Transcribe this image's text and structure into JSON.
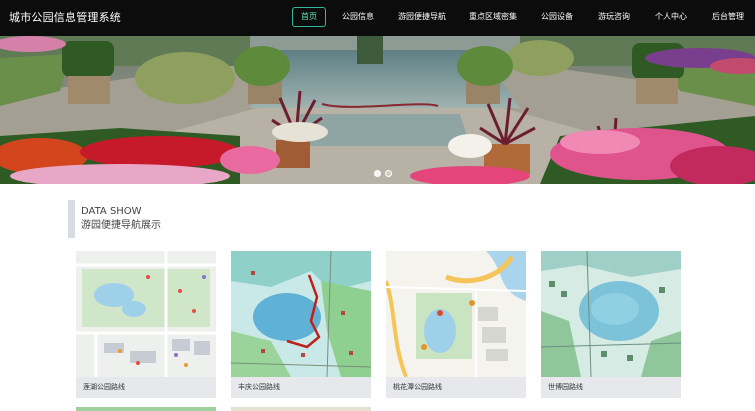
{
  "app": {
    "title": "城市公园信息管理系统"
  },
  "nav": {
    "items": [
      {
        "label": "首页",
        "active": true
      },
      {
        "label": "公园信息",
        "active": false
      },
      {
        "label": "游园便捷导航",
        "active": false
      },
      {
        "label": "重点区域密集",
        "active": false
      },
      {
        "label": "公园设备",
        "active": false
      },
      {
        "label": "游玩咨询",
        "active": false
      },
      {
        "label": "个人中心",
        "active": false
      },
      {
        "label": "后台管理",
        "active": false
      }
    ]
  },
  "banner": {
    "slide_count": 2,
    "active_slide": 1
  },
  "section": {
    "title_en": "DATA SHOW",
    "title_cn": "游园便捷导航展示"
  },
  "cards": [
    {
      "caption": "莲湖公园路线"
    },
    {
      "caption": "丰庆公园路线"
    },
    {
      "caption": "桃花潭公园路线"
    },
    {
      "caption": "世博园路线"
    }
  ],
  "colors": {
    "nav_bg": "#0c0c0c",
    "nav_active": "#36b79a",
    "caption_bg": "#e6e8eb"
  }
}
